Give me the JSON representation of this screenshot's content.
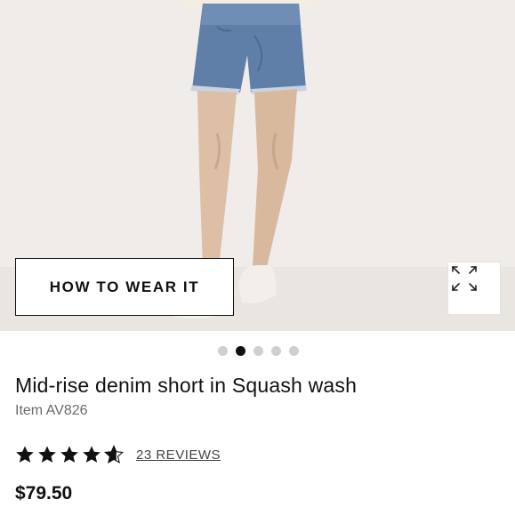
{
  "product_image": {
    "alt": "Model wearing mid-rise denim shorts",
    "how_to_wear_label": "HOW TO WEAR IT",
    "expand_icon": "expand-arrows-icon"
  },
  "carousel": {
    "count": 5,
    "active_index": 1
  },
  "product": {
    "title": "Mid-rise denim short in Squash wash",
    "item_number": "Item AV826",
    "rating": 4.5,
    "reviews_label": "23 REVIEWS",
    "price": "$79.50"
  },
  "colors": {
    "accent": "#111111",
    "muted_text": "#6b6b6b",
    "dot_inactive": "#cfcfcf"
  }
}
